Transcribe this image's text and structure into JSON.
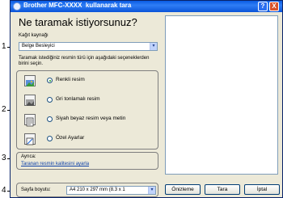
{
  "callouts": [
    "1",
    "2",
    "3",
    "4"
  ],
  "window": {
    "title": "Brother MFC-XXXX  kullanarak tara",
    "help_glyph": "?",
    "close_glyph": "X",
    "heading": "Ne taramak istiyorsunuz?",
    "paper_source": {
      "label": "Kağıt kaynağı",
      "value": "Belge Besleyici",
      "arrow": "▾"
    },
    "instructions": "Taramak istediğiniz resmin türü için aşağıdaki seçeneklerden birini seçin.",
    "options": [
      {
        "label": "Renkli resim",
        "selected": true,
        "icon": "color-photo-icon"
      },
      {
        "label": "Gri tonlamalı resim",
        "selected": false,
        "icon": "grayscale-photo-icon"
      },
      {
        "label": "Siyah beyaz resim veya metin",
        "selected": false,
        "icon": "black-white-text-icon"
      },
      {
        "label": "Özel Ayarlar",
        "selected": false,
        "icon": "custom-settings-icon"
      }
    ],
    "also_label": "Ayrıca:",
    "quality_link": "Taranan resmin kalitesini ayarla",
    "page_size": {
      "label": "Sayfa boyutu:",
      "value": "A4 210 x 297 mm (8.3 x 1",
      "arrow": "▾"
    },
    "buttons": {
      "preview": "Önizleme",
      "scan": "Tara",
      "cancel": "İptal"
    }
  }
}
